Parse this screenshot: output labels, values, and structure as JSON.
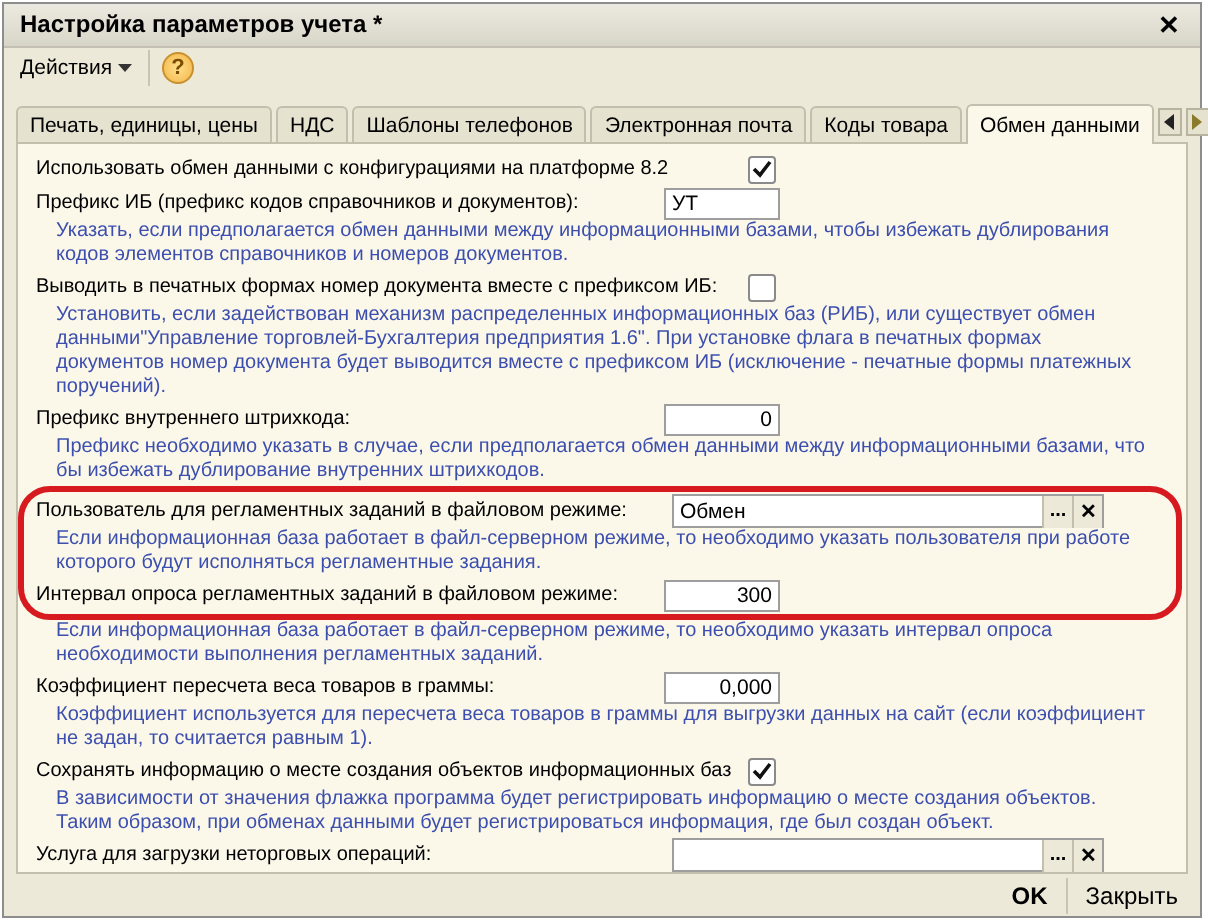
{
  "window": {
    "title": "Настройка параметров учета *",
    "close": "✕"
  },
  "toolbar": {
    "actions": "Действия",
    "help": "?"
  },
  "tabs": [
    {
      "label": "Печать, единицы, цены",
      "selected": false
    },
    {
      "label": "НДС",
      "selected": false
    },
    {
      "label": "Шаблоны телефонов",
      "selected": false
    },
    {
      "label": "Электронная почта",
      "selected": false
    },
    {
      "label": "Коды товара",
      "selected": false
    },
    {
      "label": "Обмен данными",
      "selected": true
    }
  ],
  "sections": [
    {
      "highlighted": false,
      "rows": [
        {
          "kind": "checkbox",
          "label": "Использовать обмен данными с конфигурациями на платформе 8.2",
          "checked": true
        },
        {
          "kind": "text",
          "label": "Префикс ИБ (префикс кодов справочников и документов):",
          "value": "УТ",
          "hint": "Указать, если предполагается обмен данными между информационными базами, чтобы избежать дублирования кодов элементов справочников и номеров документов."
        },
        {
          "kind": "checkbox",
          "label": "Выводить в печатных формах номер документа вместе с префиксом ИБ:",
          "checked": false,
          "hint": "Установить, если задействован механизм распределенных информационных баз (РИБ), или существует обмен данными\"Управление торговлей-Бухгалтерия предприятия 1.6\". При установке флага в печатных формах документов номер документа будет выводится вместе с префиксом ИБ (исключение - печатные формы платежных поручений)."
        },
        {
          "kind": "number",
          "label": "Префикс внутреннего штрихкода:",
          "value": "0",
          "hint": "Префикс необходимо указать в случае, если предполагается обмен данными между информационными базами, что бы избежать дублирование внутренних штрихкодов."
        }
      ]
    },
    {
      "highlighted": true,
      "rows": [
        {
          "kind": "select",
          "label": "Пользователь для регламентных заданий в файловом режиме:",
          "value": "Обмен",
          "choose": "...",
          "clear": "✕",
          "hint": "Если информационная база работает в файл-серверном режиме, то необходимо указать пользователя при работе которого будут исполняться регламентные задания."
        },
        {
          "kind": "number",
          "label": "Интервал опроса регламентных заданий в файловом режиме:",
          "value": "300"
        }
      ]
    },
    {
      "highlighted": false,
      "rows": [
        {
          "kind": "note",
          "hint": "Если информационная база работает в файл-серверном режиме, то необходимо указать интервал опроса необходимости выполнения регламентных заданий."
        },
        {
          "kind": "number",
          "label": "Коэффициент пересчета веса товаров в граммы:",
          "value": "0,000",
          "hint": "Коэффициент используется для пересчета веса товаров в граммы для выгрузки данных на сайт (если коэффициент не задан, то считается равным 1)."
        },
        {
          "kind": "checkbox",
          "label": "Сохранять информацию о месте создания объектов информационных баз",
          "checked": true,
          "hint": "В зависимости от значения флажка программа будет регистрировать информацию о месте создания объектов. Таким образом, при обменах данными будет регистрироваться информация, где был создан объект."
        },
        {
          "kind": "select",
          "label": "Услуга для загрузки неторговых операций:",
          "value": "",
          "choose": "...",
          "clear": "✕"
        }
      ]
    }
  ],
  "footer": {
    "ok": "OK",
    "close": "Закрыть"
  }
}
